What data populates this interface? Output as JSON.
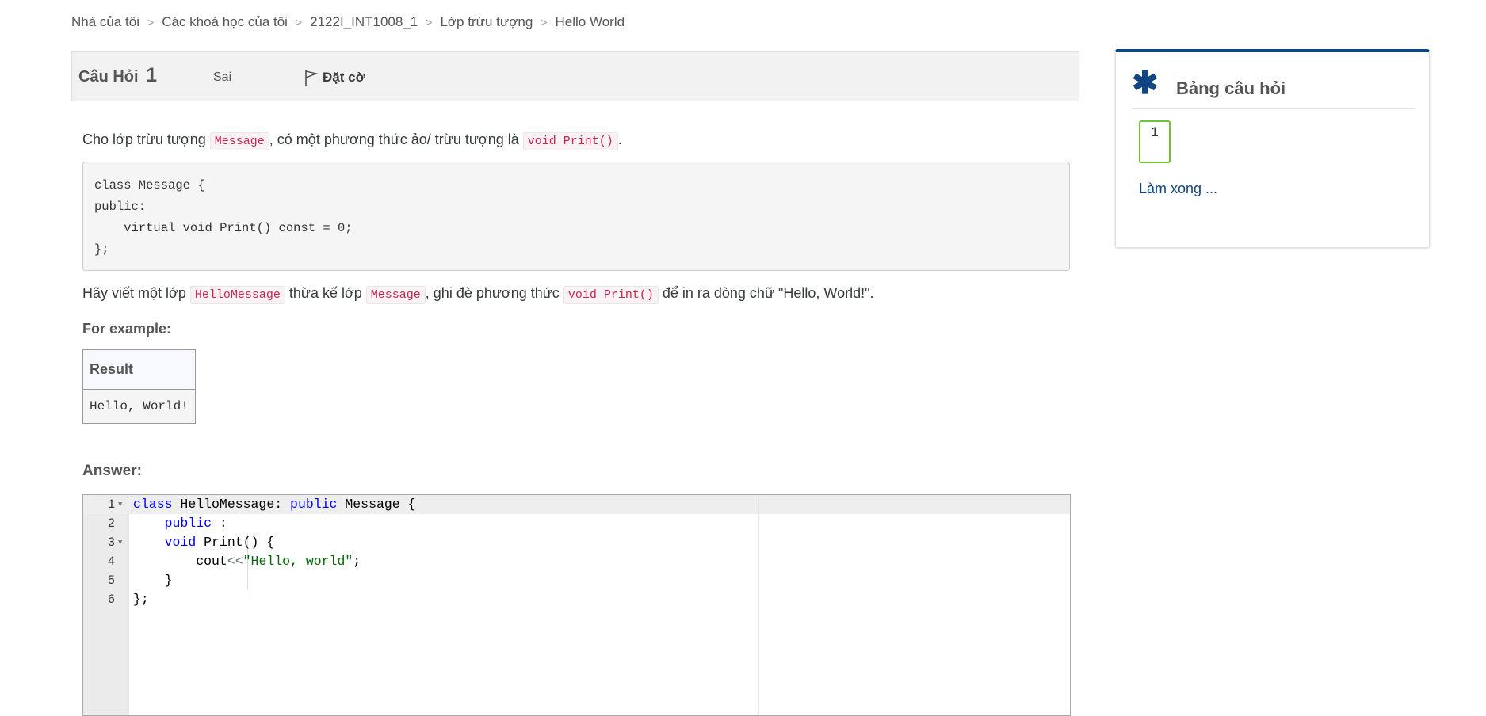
{
  "breadcrumb": [
    "Nhà của tôi",
    "Các khoá học của tôi",
    "2122I_INT1008_1",
    "Lớp trừu tượng",
    "Hello World"
  ],
  "question": {
    "label": "Câu Hỏi",
    "number": "1",
    "state": "Sai",
    "flag_label": "Đặt cờ"
  },
  "text1": {
    "a": "Cho lớp trừu tượng ",
    "code1": "Message",
    "b": ", có một phương thức ảo/ trừu tượng là ",
    "code2": "void Print()",
    "c": "."
  },
  "code_block": "class Message {\npublic:\n    virtual void Print() const = 0;\n};",
  "text2": {
    "a": "Hãy viết một lớp ",
    "code1": "HelloMessage",
    "b": " thừa kế lớp ",
    "code2": "Message",
    "c": ", ghi đè phương thức ",
    "code3": "void Print()",
    "d": " để in ra dòng chữ \"Hello, World!\"."
  },
  "for_example": "For example:",
  "example_table": {
    "header": "Result",
    "value": "Hello, World!"
  },
  "answer_label": "Answer:",
  "editor": {
    "line_numbers": [
      "1",
      "2",
      "3",
      "4",
      "5",
      "6"
    ],
    "fold_marker": "▼",
    "l1": {
      "kw1": "class",
      "t1": " HelloMessage: ",
      "kw2": "public",
      "t2": " Message {"
    },
    "l2": {
      "kw1": "public",
      "t1": " :"
    },
    "l3": {
      "kw1": "void",
      "t1": " Print() {"
    },
    "l4": {
      "t1": "cout",
      "op": "<<",
      "str": "\"Hello, world\"",
      "t2": ";"
    },
    "l5": {
      "t1": "}"
    },
    "l6": {
      "t1": "};"
    }
  },
  "nav": {
    "icon": "asterisk-icon",
    "title": "Bảng câu hỏi",
    "question_button": "1",
    "finish_link": "Làm xong ..."
  },
  "colors": {
    "brand": "#0f4581",
    "answered_border": "#6ec335",
    "code_inline": "#c7254e",
    "keyword": "#0000ff",
    "string": "#036a07"
  }
}
